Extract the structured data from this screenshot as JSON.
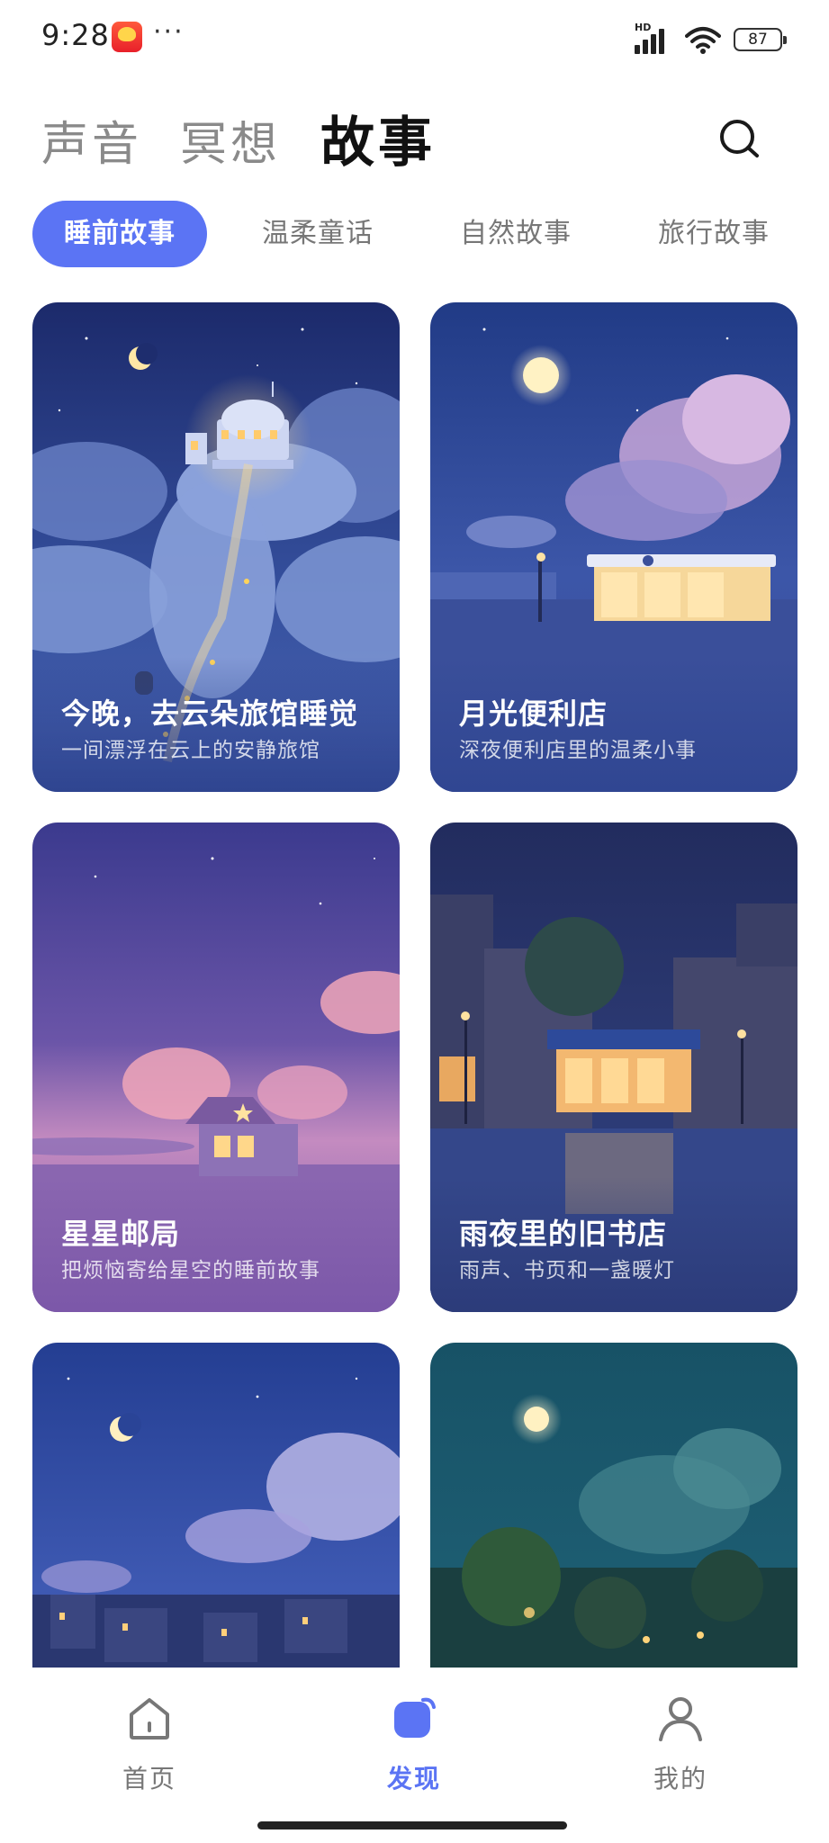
{
  "status_bar": {
    "time": "9:28",
    "more": "···",
    "network": "HD",
    "battery": "87",
    "app_icon": "shopping-app-icon"
  },
  "header": {
    "tabs": [
      {
        "label": "声音",
        "selected": false
      },
      {
        "label": "冥想",
        "selected": false
      },
      {
        "label": "故事",
        "selected": true
      }
    ],
    "search_icon": "search-icon"
  },
  "categories": [
    {
      "label": "睡前故事",
      "selected": true
    },
    {
      "label": "温柔童话",
      "selected": false
    },
    {
      "label": "自然故事",
      "selected": false
    },
    {
      "label": "旅行故事",
      "selected": false
    }
  ],
  "stories": [
    {
      "title": "今晚，去云朵旅馆睡觉",
      "subtitle": "一间漂浮在云上的安静旅馆"
    },
    {
      "title": "月光便利店",
      "subtitle": "深夜便利店里的温柔小事"
    },
    {
      "title": "星星邮局",
      "subtitle": "把烦恼寄给星空的睡前故事"
    },
    {
      "title": "雨夜里的旧书店",
      "subtitle": "雨声、书页和一盏暖灯"
    },
    {
      "title": "",
      "subtitle": ""
    },
    {
      "title": "",
      "subtitle": ""
    }
  ],
  "bottom_nav": [
    {
      "label": "首页",
      "icon": "home-icon",
      "selected": false
    },
    {
      "label": "发现",
      "icon": "discover-icon",
      "selected": true
    },
    {
      "label": "我的",
      "icon": "profile-icon",
      "selected": false
    }
  ],
  "colors": {
    "accent": "#5b74f4",
    "tab_inactive": "#8a8a8a",
    "tab_active": "#111111"
  }
}
